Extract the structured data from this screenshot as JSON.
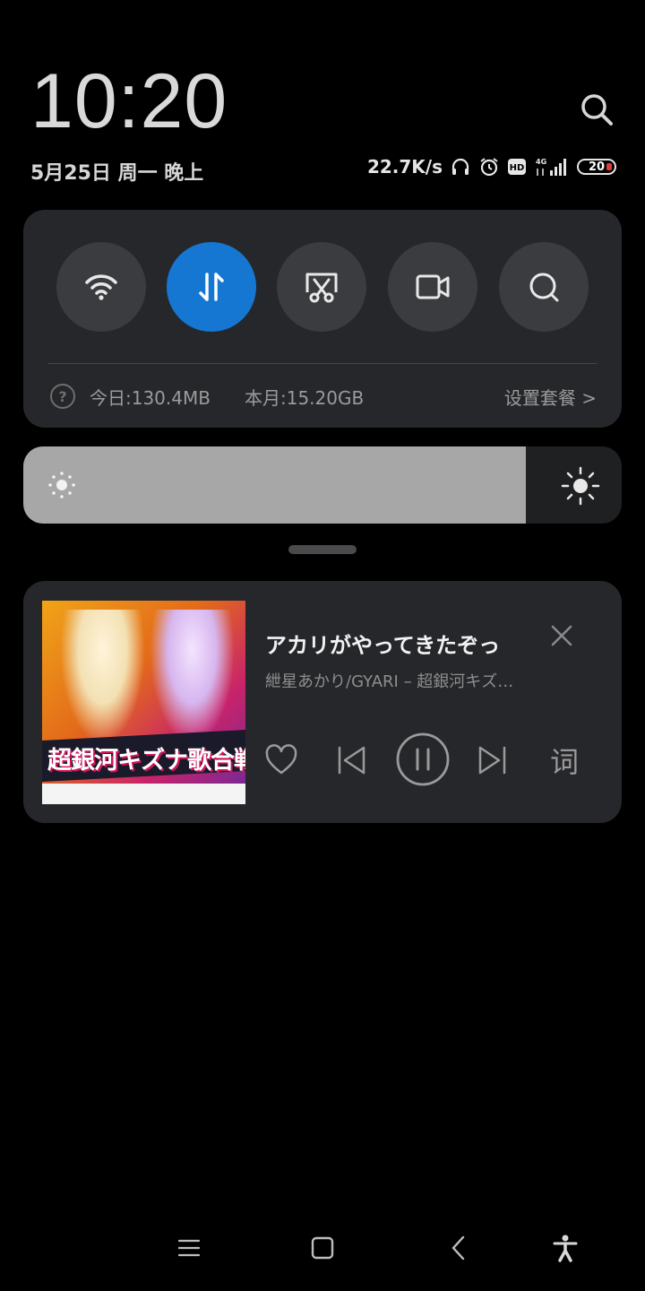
{
  "header": {
    "time": "10:20",
    "date": "5月25日 周一 晚上",
    "net_speed": "22.7K/s",
    "battery_level": "20",
    "network_type": "4G"
  },
  "quick_settings": {
    "toggles": [
      {
        "name": "wifi",
        "icon": "wifi-icon",
        "active": false
      },
      {
        "name": "mobile-data",
        "icon": "data-arrows-icon",
        "active": true
      },
      {
        "name": "screenshot",
        "icon": "scissors-screenshot-icon",
        "active": false
      },
      {
        "name": "screen-record",
        "icon": "video-camera-icon",
        "active": false
      },
      {
        "name": "search",
        "icon": "search-icon",
        "active": false
      }
    ],
    "usage_today": "今日:130.4MB",
    "usage_month": "本月:15.20GB",
    "set_plan": "设置套餐 >",
    "accent_color": "#1677d2"
  },
  "brightness": {
    "level": 0.84
  },
  "media": {
    "title": "アカリがやってきたぞっ",
    "artist": "紲星あかり/GYARI – 超銀河キズナ歌合戦",
    "album_art_text": "超銀河キズナ歌合戦",
    "lyrics_label": "词",
    "state": "playing"
  },
  "navbar": {
    "buttons": [
      "menu",
      "home",
      "back",
      "accessibility"
    ]
  }
}
